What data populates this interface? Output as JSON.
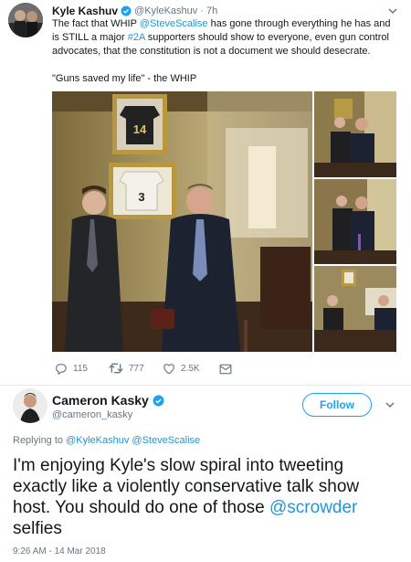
{
  "tweet1": {
    "name": "Kyle Kashuv",
    "handle": "@KyleKashuv",
    "sep": "·",
    "time": "7h",
    "text": {
      "p1": "The fact that WHIP ",
      "mention": "@SteveScalise",
      "p2": " has gone through everything he has and is STILL a major ",
      "hashtag": "#2A",
      "p3": " supporters should show to everyone, even gun control advocates, that the constitution is not a document we should desecrate."
    },
    "quote": "\"Guns saved my life\" - the WHIP",
    "photo_text": {
      "jersey1": "14",
      "jersey2": "3"
    },
    "actions": {
      "replies": "115",
      "retweets": "777",
      "likes": "2.5K"
    }
  },
  "tweet2": {
    "name": "Cameron Kasky",
    "handle": "@cameron_kasky",
    "follow_label": "Follow",
    "replying_prefix": "Replying to ",
    "replying_to1": "@KyleKashuv",
    "replying_to2": "@SteveScalise",
    "text": {
      "p1": "I'm enjoying Kyle's slow spiral into tweeting exactly like a violently conservative talk show host. You should do one of those ",
      "mention": "@scrowder",
      "p2": " selfies"
    },
    "timestamp": "9:26 AM - 14 Mar 2018"
  },
  "colors": {
    "link": "#1b95e0",
    "verified": "#1da1f2",
    "secondary": "#657786"
  },
  "icons": [
    "verified-badge-icon",
    "chevron-down-icon",
    "reply-icon",
    "retweet-icon",
    "like-icon",
    "message-icon"
  ]
}
